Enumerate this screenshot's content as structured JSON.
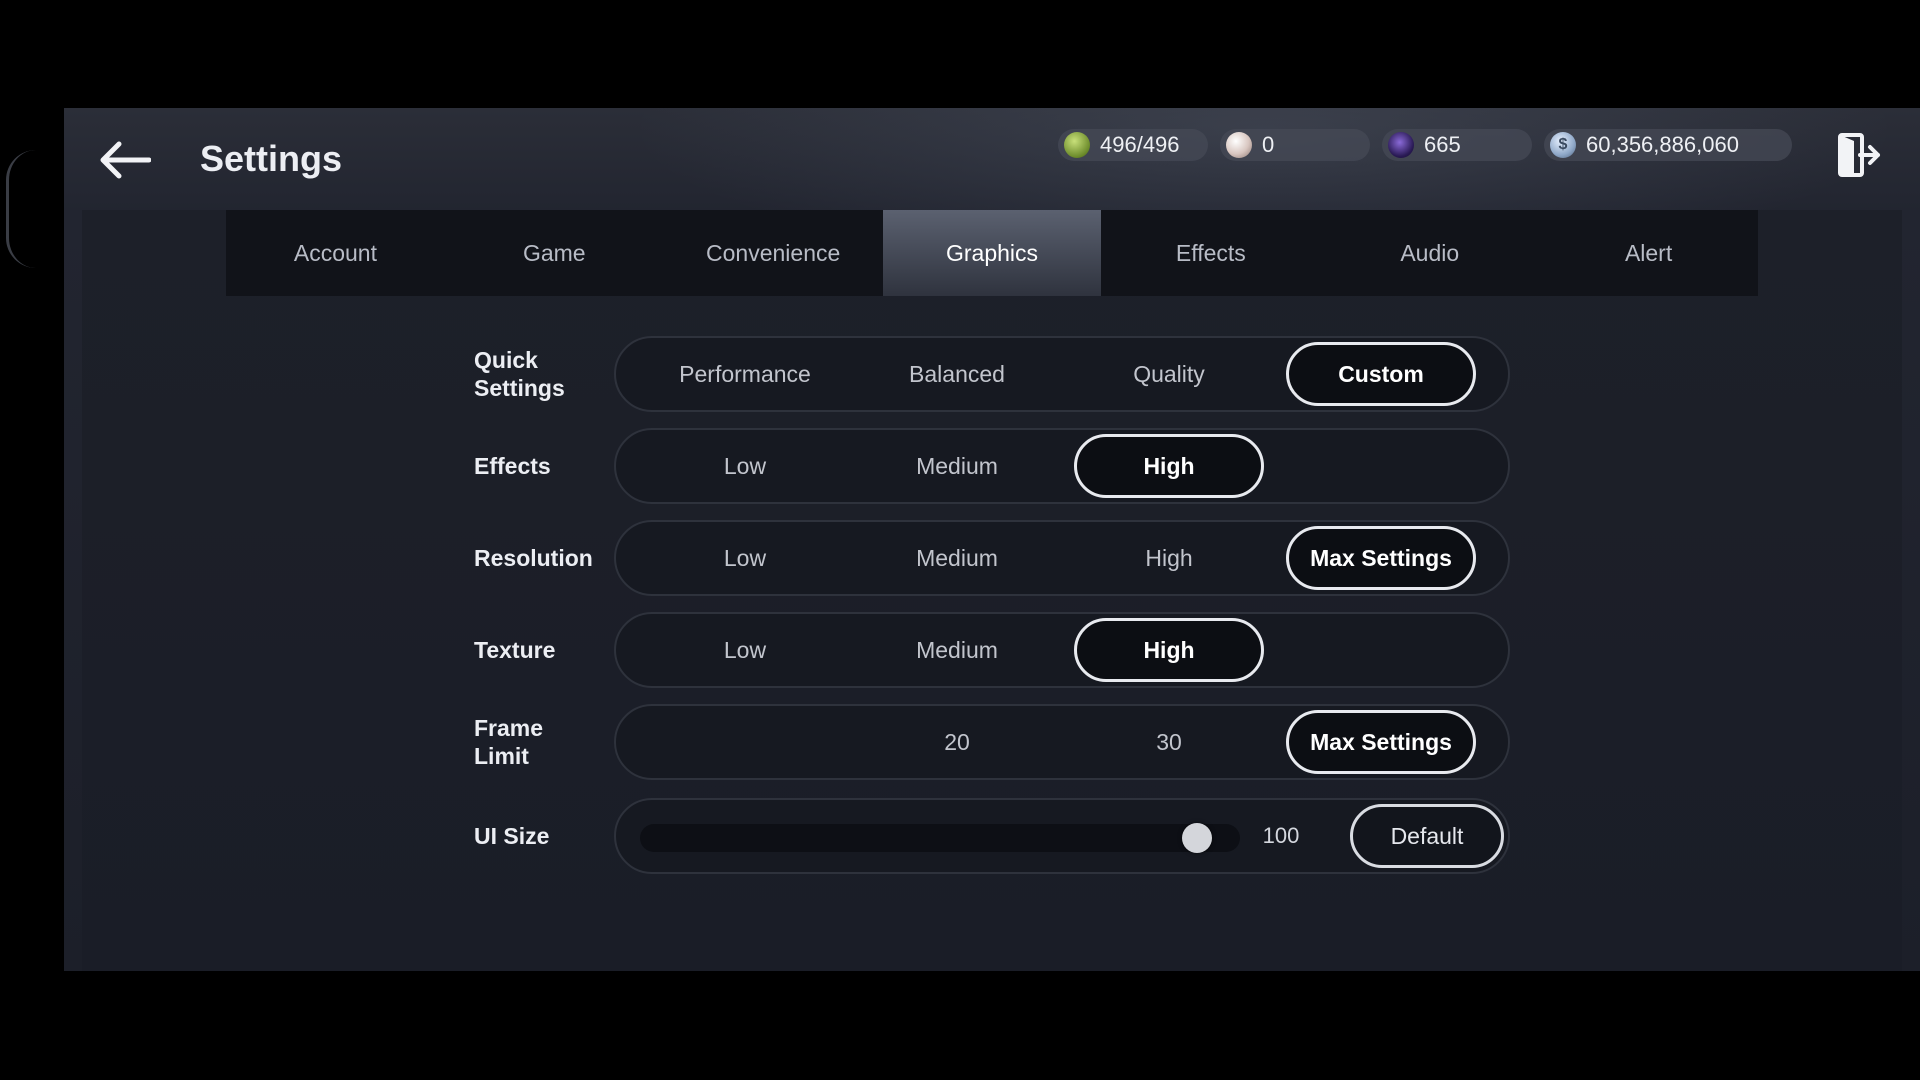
{
  "header": {
    "title": "Settings"
  },
  "currencies": [
    {
      "icon": "green-gem-icon",
      "value": "496/496",
      "color": "#8fb04a"
    },
    {
      "icon": "pearl-icon",
      "value": "0",
      "color": "#c9b7b2"
    },
    {
      "icon": "purple-orb-icon",
      "value": "665",
      "color": "#3b2a6e"
    },
    {
      "icon": "silver-coin-icon",
      "value": "60,356,886,060",
      "color": "#a9bed8"
    }
  ],
  "tabs": [
    {
      "label": "Account",
      "active": false
    },
    {
      "label": "Game",
      "active": false
    },
    {
      "label": "Convenience",
      "active": false
    },
    {
      "label": "Graphics",
      "active": true
    },
    {
      "label": "Effects",
      "active": false
    },
    {
      "label": "Audio",
      "active": false
    },
    {
      "label": "Alert",
      "active": false
    }
  ],
  "settings": {
    "quick_settings": {
      "label": "Quick Settings",
      "options": [
        "Performance",
        "Balanced",
        "Quality",
        "Custom"
      ],
      "selected": "Custom"
    },
    "effects": {
      "label": "Effects",
      "options": [
        "Low",
        "Medium",
        "High"
      ],
      "selected": "High"
    },
    "resolution": {
      "label": "Resolution",
      "options": [
        "Low",
        "Medium",
        "High",
        "Max Settings"
      ],
      "selected": "Max Settings"
    },
    "texture": {
      "label": "Texture",
      "options": [
        "Low",
        "Medium",
        "High"
      ],
      "selected": "High"
    },
    "frame_limit": {
      "label": "Frame Limit",
      "options": [
        "20",
        "30",
        "Max Settings"
      ],
      "selected": "Max Settings"
    },
    "ui_size": {
      "label": "UI Size",
      "value": "100",
      "fraction": 0.95,
      "default_label": "Default"
    }
  },
  "colors": {
    "accent_selected_border": "#e8eaef",
    "panel_bg": "#1a1d27",
    "tab_bar_bg": "#111319"
  }
}
